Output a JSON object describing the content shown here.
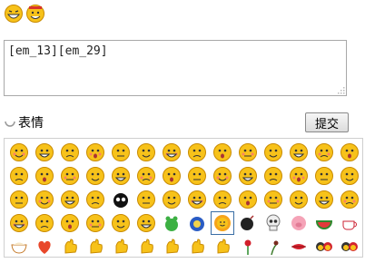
{
  "preview": [
    "em_13",
    "em_29"
  ],
  "editor": {
    "value": "[em_13][em_29]"
  },
  "toolbar": {
    "label": "表情",
    "submit_label": "提交"
  },
  "colors": {
    "face": "#f7c21a",
    "face_edge": "#c88a00",
    "selection": "#3a6ea5"
  },
  "emoji_rows": [
    [
      "smile",
      "blush",
      "heart-eyes",
      "laugh",
      "cry",
      "sweat",
      "blank",
      "shy",
      "sleepy",
      "angry",
      "rage",
      "grin",
      "sigh",
      "smirk"
    ],
    [
      "hungry",
      "sad",
      "snicker",
      "sweat-drop",
      "yawn",
      "dizzy",
      "whistle",
      "smug",
      "sulk",
      "mad",
      "cool",
      "hat",
      "cry-tears",
      "clap"
    ],
    [
      "surprised",
      "shocked",
      "puzzled",
      "bashful",
      "skull-bomb",
      "scared",
      "cheeky",
      "wink",
      "meh",
      "hmm",
      "laugh-hand",
      "big-grin",
      "scoff",
      "angry-steam"
    ],
    [
      "bored",
      "shy-blush",
      "weep",
      "bye",
      "purple-cry",
      "skeptic",
      "frog",
      "blue-bear",
      "sun-face",
      "bomb",
      "skull",
      "pig",
      "watermelon",
      "teacup"
    ],
    [
      "rice",
      "heart",
      "thumbs-up",
      "thumbs-down",
      "handshake",
      "victory",
      "fist",
      "point",
      "ok",
      "rose",
      "wilted-rose",
      "lips",
      "couple",
      "kiss"
    ]
  ],
  "selected": "sun-face"
}
